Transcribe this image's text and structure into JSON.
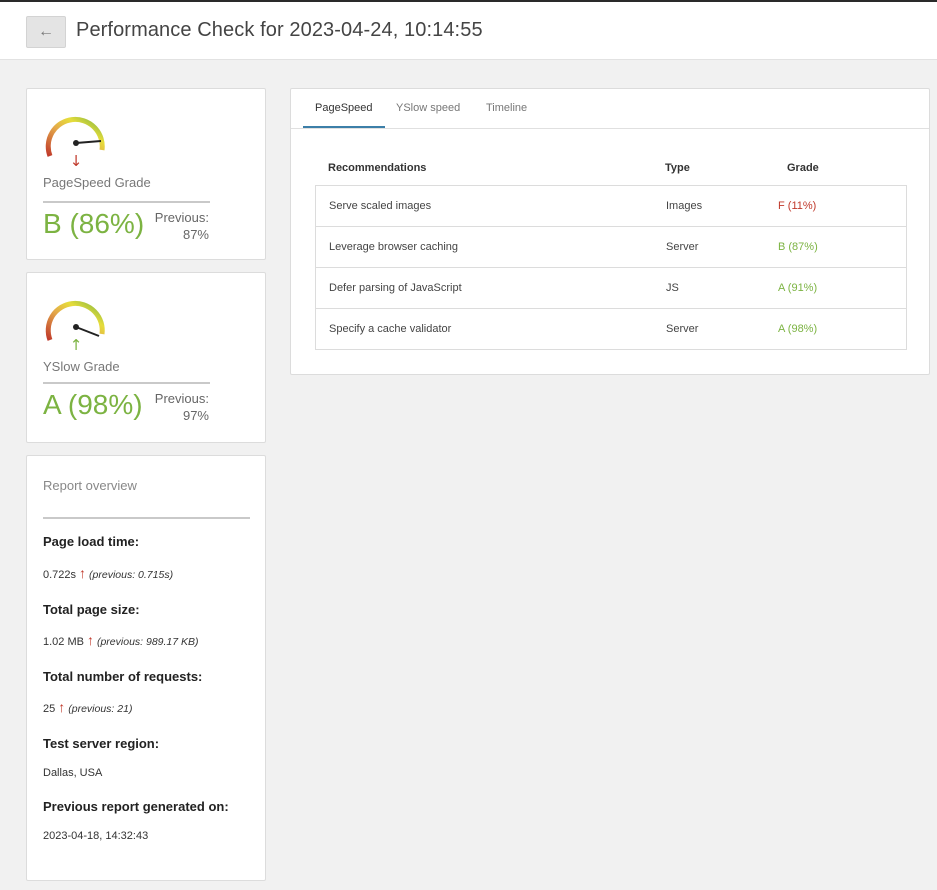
{
  "header": {
    "back_icon": "arrow-left-icon",
    "back_label": "←",
    "title": "Performance Check for 2023-04-24, 10:14:55"
  },
  "pagespeed": {
    "label": "PageSpeed Grade",
    "grade": "B (86%)",
    "previous_label": "Previous:",
    "previous_value": "87%",
    "trend_icon": "arrow-down-icon",
    "trend_glyph": "↓",
    "trend_color": "#c0392b",
    "score": 0.86
  },
  "yslow": {
    "label": "YSlow Grade",
    "grade": "A (98%)",
    "previous_label": "Previous:",
    "previous_value": "97%",
    "trend_icon": "arrow-up-icon",
    "trend_glyph": "↑",
    "trend_color": "#7cb342",
    "score": 0.98
  },
  "overview": {
    "title": "Report overview",
    "load_time": {
      "heading": "Page load time:",
      "value": "0.722s",
      "arrow": "↑",
      "previous": "(previous: 0.715s)"
    },
    "page_size": {
      "heading": "Total page size:",
      "value": "1.02 MB",
      "arrow": "↑",
      "previous": "(previous: 989.17 KB)"
    },
    "requests": {
      "heading": "Total number of requests:",
      "value": "25",
      "arrow": "↑",
      "previous": "(previous: 21)"
    },
    "region": {
      "heading": "Test server region:",
      "value": "Dallas, USA"
    },
    "prev_report": {
      "heading": "Previous report generated on:",
      "value": "2023-04-18, 14:32:43"
    }
  },
  "tabs": [
    "PageSpeed",
    "YSlow speed",
    "Timeline"
  ],
  "table": {
    "headers": [
      "Recommendations",
      "Type",
      "Grade"
    ],
    "rows": [
      {
        "recommendation": "Serve scaled images",
        "type": "Images",
        "grade": "F (11%)",
        "status": "bad"
      },
      {
        "recommendation": "Leverage browser caching",
        "type": "Server",
        "grade": "B (87%)",
        "status": "good"
      },
      {
        "recommendation": "Defer parsing of JavaScript",
        "type": "JS",
        "grade": "A (91%)",
        "status": "good"
      },
      {
        "recommendation": "Specify a cache validator",
        "type": "Server",
        "grade": "A (98%)",
        "status": "good"
      }
    ]
  },
  "colors": {
    "good": "#7cb342",
    "bad": "#c0392b",
    "tab_accent": "#3c7fa8"
  }
}
